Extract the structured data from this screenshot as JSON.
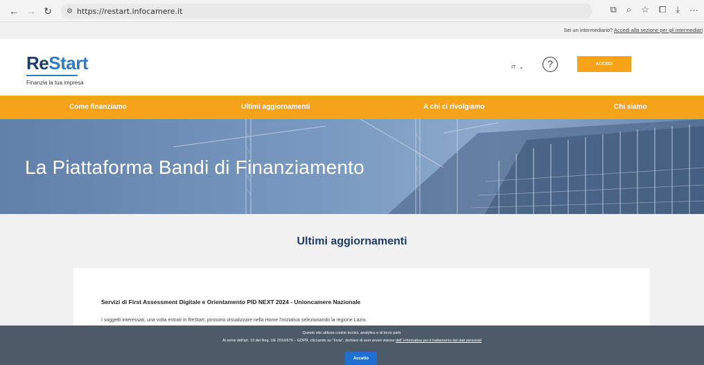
{
  "browser": {
    "url": "https://restart.infocamere.it"
  },
  "topstrip": {
    "question": "Sei un intermediario?",
    "link": "Accedi alla sezione per gli intermediari"
  },
  "header": {
    "logo_re": "Re",
    "logo_start": "Start",
    "tagline": "Finanzia la tua impresa",
    "language": "IT",
    "help": "?",
    "accedi_label": "ACCEDI"
  },
  "nav": {
    "items": [
      {
        "label": "Come finanziamo"
      },
      {
        "label": "Ultimi aggiornamenti"
      },
      {
        "label": "A chi ci rivolgiamo"
      },
      {
        "label": "Chi siamo"
      }
    ]
  },
  "hero": {
    "title": "La Piattaforma Bandi di Finanziamento"
  },
  "updates": {
    "section_title": "Ultimi aggiornamenti",
    "item_title": "Servizi di First Assessment Digitale e Orientamento PID NEXT 2024 - Unioncamere Nazionale",
    "item_text": "I soggetti interessati, una volta entrati in ReStart, possono visualizzare nella Home l'iniziativa selezionando la regione Lazio."
  },
  "cookie": {
    "line1": "Questo sito utilizza cookie tecnici, analytics e di terze parti.",
    "line2_prefix": "Ai sensi dell'art. 13 del Reg. UE 2016/679 – GDPR, cliccando su \"Invia\", dichiaro di aver preso visione",
    "line2_link": "dell' informativa per il trattamento dei dati personali",
    "accept_label": "Accetto"
  },
  "colors": {
    "accent": "#f6a31a",
    "brand_dark": "#1c3c6b",
    "brand_light": "#2f79c5",
    "cookie_bg": "#4d5a68",
    "accept_button": "#1f6fd1"
  }
}
